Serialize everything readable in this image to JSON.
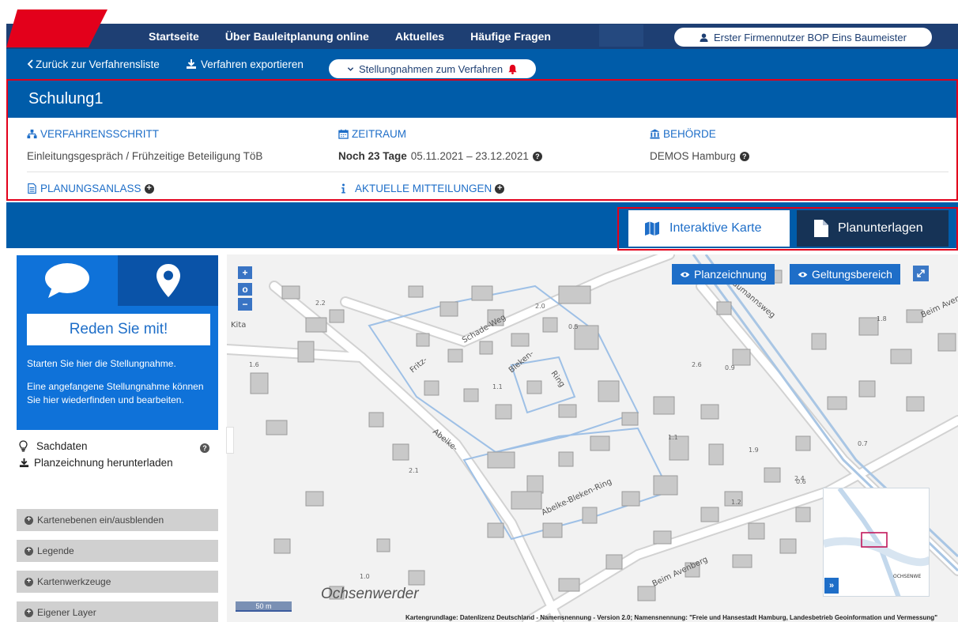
{
  "nav": {
    "items": [
      "Startseite",
      "Über Bauleitplanung online",
      "Aktuelles",
      "Häufige Fragen"
    ],
    "user": "Erster Firmennutzer BOP Eins Baumeister"
  },
  "subnav": {
    "back": "Zurück zur Verfahrensliste",
    "export": "Verfahren exportieren",
    "statements": "Stellungnahmen zum Verfahren"
  },
  "procedure": {
    "title": "Schulung1",
    "step_label": "VERFAHRENSSCHRITT",
    "step_value": "Einleitungsgespräch / Frühzeitige Beteiligung TöB",
    "period_label": "ZEITRAUM",
    "period_remaining": "Noch 23 Tage",
    "period_dates": "05.11.2021 – 23.12.2021",
    "authority_label": "BEHÖRDE",
    "authority_value": "DEMOS Hamburg",
    "reason_label": "PLANUNGSANLASS",
    "news_label": "AKTUELLE MITTEILUNGEN"
  },
  "tabs": {
    "map": "Interaktive Karte",
    "documents": "Planunterlagen"
  },
  "sidebar": {
    "cta": "Reden Sie mit!",
    "start_text": "Starten Sie hier die Stellungnahme.",
    "resume_text": "Eine angefangene Stellungnahme können Sie hier wiederfinden und bearbeiten.",
    "facts": "Sachdaten",
    "download": "Planzeichnung herunterladen",
    "layers": "Kartenebenen ein/ausblenden",
    "legend": "Legende",
    "tools": "Kartenwerkzeuge",
    "own_layer": "Eigener Layer"
  },
  "map": {
    "btn_plan": "Planzeichnung",
    "btn_scope": "Geltungsbereich",
    "zoom_in": "+",
    "zoom_reset": "o",
    "zoom_out": "−",
    "place": "Ochsenwerder",
    "scale": "50 m",
    "ov_toggle": "»",
    "ov_label": "OCHSENWE",
    "attribution": "Kartengrundlage: Datenlizenz Deutschland - Namensnennung - Version 2.0; Namensnennung: \"Freie und Hansestadt Hamburg, Landesbetrieb Geoinformation und Vermessung\"",
    "street_labels": [
      "Fritz-",
      "Schade-Weg",
      "Bleken-",
      "Ring",
      "Abeike-",
      "Abelke-Bleken-Ring",
      "Beim Avenberg",
      "Graumannsweg",
      "Beim Avenberg",
      "Kita"
    ],
    "height_labels": [
      "2.2",
      "2.0",
      "0.5",
      "1.6",
      "1.1",
      "2.6",
      "0.9",
      "1.8",
      "1.1",
      "1.9",
      "0.7",
      "2.1",
      "1.2",
      "2.4",
      "1.0",
      "2.9",
      "0.6"
    ]
  },
  "colors": {
    "nav_dark": "#1e3f73",
    "primary": "#005ca9",
    "accent": "#1e6ec8",
    "sidebar": "#0f72d9",
    "highlight": "#e3001b"
  }
}
